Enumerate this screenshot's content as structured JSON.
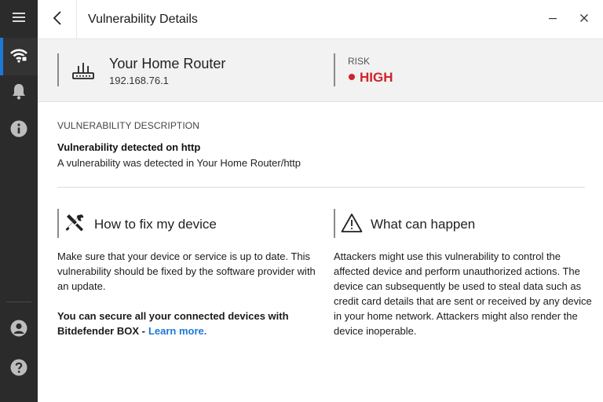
{
  "window": {
    "title": "Vulnerability Details",
    "minimize_glyph": "—",
    "close_glyph": "✕"
  },
  "sidebar": {
    "items": [
      {
        "name": "menu",
        "icon": "hamburger-icon",
        "active": false
      },
      {
        "name": "network",
        "icon": "wifi-icon",
        "active": true
      },
      {
        "name": "notifications",
        "icon": "bell-icon",
        "active": false
      },
      {
        "name": "info",
        "icon": "info-icon",
        "active": false
      },
      {
        "name": "account",
        "icon": "user-icon",
        "active": false
      },
      {
        "name": "help",
        "icon": "help-icon",
        "active": false
      }
    ]
  },
  "device": {
    "icon": "router-icon",
    "name": "Your Home Router",
    "ip": "192.168.76.1",
    "risk_label": "RISK",
    "risk_value": "HIGH",
    "risk_color": "#d1232a"
  },
  "description": {
    "section_label": "VULNERABILITY DESCRIPTION",
    "title": "Vulnerability detected on http",
    "text": "A vulnerability was detected in Your Home Router/http"
  },
  "fix": {
    "icon": "tools-icon",
    "heading": "How to fix my device",
    "paragraph": "Make sure that your device or service is up to date. This vulnerability should be fixed by the software provider with an update.",
    "promo": "You can secure all your connected devices with Bitdefender BOX -",
    "link": "Learn more."
  },
  "impact": {
    "icon": "warning-icon",
    "heading": "What can happen",
    "paragraph": "Attackers might use this vulnerability to control the affected device and perform unauthorized actions. The device can subsequently be used to steal data such as credit card details that are sent or received by any device in your home network. Attackers might also render the device inoperable."
  },
  "colors": {
    "accent": "#1e78d7",
    "sidebar_bg": "#2b2b2b",
    "band_bg": "#f2f2f2",
    "risk_high": "#d1232a"
  }
}
